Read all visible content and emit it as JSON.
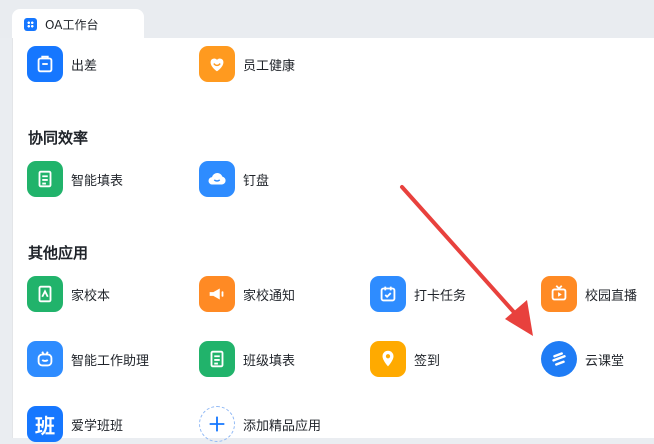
{
  "tab": {
    "title": "OA工作台"
  },
  "sections": [
    {
      "title": "协同效率"
    },
    {
      "title": "其他应用"
    }
  ],
  "apps": {
    "travel": {
      "label": "出差",
      "color": "#1677ff",
      "icon": "suitcase-icon"
    },
    "health": {
      "label": "员工健康",
      "color": "#ff9a1f",
      "icon": "heart-icon"
    },
    "smart_form": {
      "label": "智能填表",
      "color": "#21b36b",
      "icon": "form-icon"
    },
    "dingpan": {
      "label": "钉盘",
      "color": "#2e8cff",
      "icon": "cloud-icon"
    },
    "homework": {
      "label": "家校本",
      "color": "#21b36b",
      "icon": "notebook-icon"
    },
    "notice": {
      "label": "家校通知",
      "color": "#ff8a24",
      "icon": "megaphone-icon"
    },
    "checkin_task": {
      "label": "打卡任务",
      "color": "#2e8cff",
      "icon": "calendar-check-icon"
    },
    "live": {
      "label": "校园直播",
      "color": "#ff8a24",
      "icon": "tv-play-icon"
    },
    "assistant": {
      "label": "智能工作助理",
      "color": "#2e8cff",
      "icon": "robot-icon"
    },
    "class_form": {
      "label": "班级填表",
      "color": "#21b36b",
      "icon": "form-icon"
    },
    "signin": {
      "label": "签到",
      "color": "#ffaa00",
      "icon": "location-pin-icon"
    },
    "cloud_class": {
      "label": "云课堂",
      "color": "#1f7cf5",
      "icon": "stripes-icon"
    },
    "ai_class": {
      "label": "爱学班班",
      "icon_text": "班",
      "color": "#1677ff"
    },
    "add_app": {
      "label": "添加精品应用",
      "color": "#1677ff",
      "icon": "plus-icon"
    }
  },
  "annotation": {
    "color": "#e8413d"
  }
}
